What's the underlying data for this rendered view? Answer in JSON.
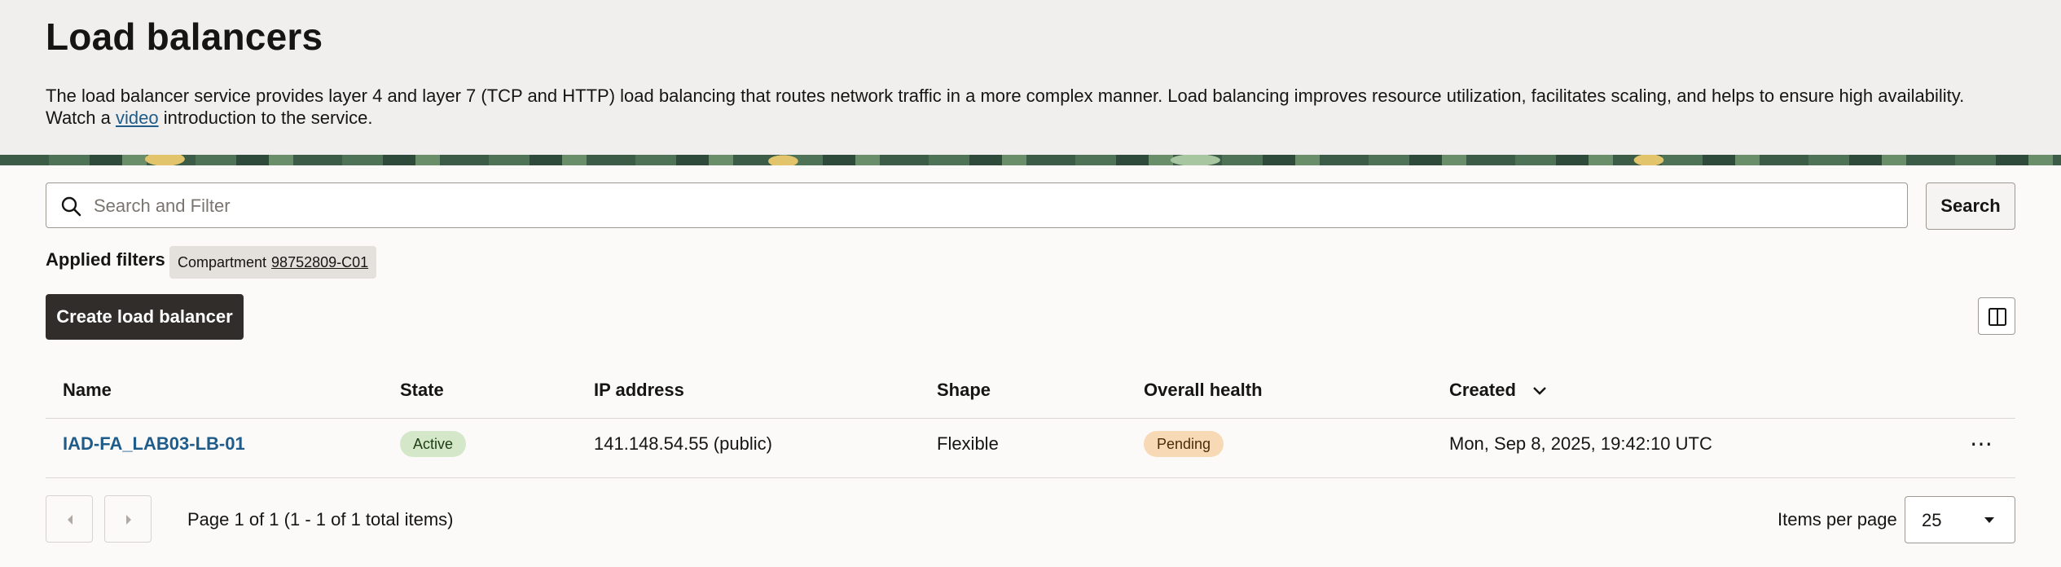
{
  "header": {
    "title": "Load balancers",
    "description": "The load balancer service provides layer 4 and layer 7 (TCP and HTTP) load balancing that routes network traffic in a more complex manner. Load balancing improves resource utilization, facilitates scaling, and helps to ensure high availability. Watch a ",
    "video_link": "video",
    "description_end": " introduction to the service."
  },
  "search": {
    "placeholder": "Search and Filter",
    "value": "",
    "button_label": "Search",
    "icon": "search-icon"
  },
  "filters": {
    "label": "Applied filters",
    "chips": [
      {
        "key": "Compartment",
        "value": "98752809-C01"
      }
    ]
  },
  "toolbar": {
    "create_label": "Create load balancer",
    "columns_icon": "columns-icon"
  },
  "table": {
    "columns": [
      "Name",
      "State",
      "IP address",
      "Shape",
      "Overall health",
      "Created"
    ],
    "sort_column": "Created",
    "sort_direction": "descending",
    "rows": [
      {
        "name": "IAD-FA_LAB03-LB-01",
        "state": "Active",
        "ip": "141.148.54.55 (public)",
        "shape": "Flexible",
        "health": "Pending",
        "created": "Mon, Sep 8, 2025, 19:42:10 UTC",
        "actions": "⋯"
      }
    ]
  },
  "pagination": {
    "info": "Page 1 of 1 (1 - 1 of 1 total items)",
    "items_per_page_label": "Items per page",
    "items_per_page": "25"
  },
  "colors": {
    "link": "#1f5c8a",
    "active_badge": "#d4e8c9",
    "pending_badge": "#f7dab5",
    "primary_button": "#312d2a"
  }
}
